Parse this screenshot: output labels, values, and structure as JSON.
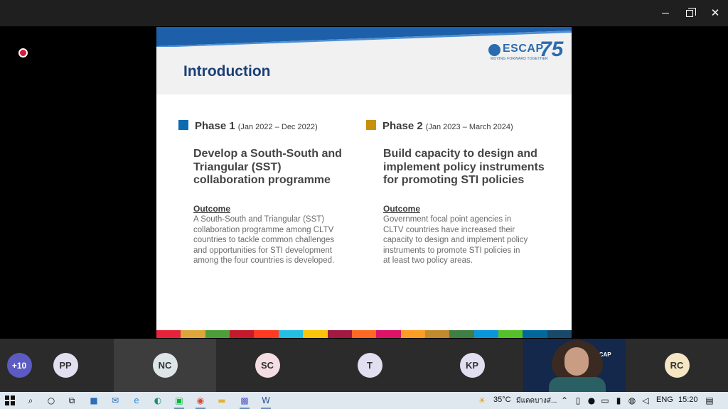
{
  "slide": {
    "title": "Introduction",
    "logo": {
      "name": "ESCAP",
      "number": "75",
      "tagline": "MOVING FORWARD TOGETHER"
    },
    "phase1": {
      "label": "Phase 1",
      "dates": "(Jan 2022 – Dec 2022)",
      "color": "#0a6ab2",
      "goal": "Develop a South-South and Triangular (SST) collaboration programme",
      "outcome_heading": "Outcome",
      "outcome_text": "A South-South and Triangular (SST) collaboration programme among CLTV countries to tackle common challenges and opportunities for STI development among the four countries is developed."
    },
    "phase2": {
      "label": "Phase 2",
      "dates": "(Jan 2023 – March 2024)",
      "color": "#c7900c",
      "goal": "Build capacity to design and implement policy instruments for promoting STI policies",
      "outcome_heading": "Outcome",
      "outcome_text": "Government focal point agencies in CLTV countries have increased their capacity to design and implement policy instruments to promote STI policies in at least two policy areas."
    },
    "sdg_colors": [
      "#e5243b",
      "#dda63a",
      "#4c9f38",
      "#c5192d",
      "#ff3a21",
      "#26bde2",
      "#fcc30b",
      "#a21942",
      "#fd6925",
      "#dd1367",
      "#fd9d24",
      "#bf8b2e",
      "#3f7e44",
      "#0a97d9",
      "#56c02b",
      "#00689d",
      "#19486a"
    ]
  },
  "participants": [
    {
      "initials": "+10",
      "style": "more"
    },
    {
      "initials": "PP",
      "style": "plain"
    },
    {
      "initials": "NC",
      "style": "nc"
    },
    {
      "initials": "SC",
      "style": "sc"
    },
    {
      "initials": "T",
      "style": "plain"
    },
    {
      "initials": "KP",
      "style": "plain"
    },
    {
      "initials": "RC",
      "style": "rc"
    }
  ],
  "video_tile": {
    "logo_text": "ESCAP"
  },
  "taskbar": {
    "weather": "35°C",
    "weather_desc": "มีแดดบางส่...",
    "language": "ENG",
    "time": "15:20"
  }
}
